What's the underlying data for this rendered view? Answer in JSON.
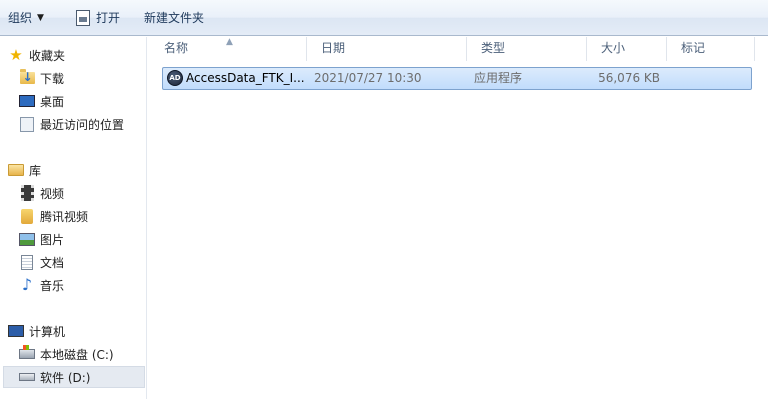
{
  "toolbar": {
    "organize_label": "组织",
    "open_label": "打开",
    "new_folder_label": "新建文件夹"
  },
  "nav": {
    "favorites": {
      "label": "收藏夹",
      "items": [
        {
          "label": "下载",
          "icon": "downloads-folder-icon"
        },
        {
          "label": "桌面",
          "icon": "desktop-icon"
        },
        {
          "label": "最近访问的位置",
          "icon": "recent-places-icon"
        }
      ]
    },
    "libraries": {
      "label": "库",
      "items": [
        {
          "label": "视频",
          "icon": "video-icon"
        },
        {
          "label": "腾讯视频",
          "icon": "tencent-video-folder-icon"
        },
        {
          "label": "图片",
          "icon": "pictures-icon"
        },
        {
          "label": "文档",
          "icon": "documents-icon"
        },
        {
          "label": "音乐",
          "icon": "music-icon"
        }
      ]
    },
    "computer": {
      "label": "计算机",
      "items": [
        {
          "label": "本地磁盘 (C:)",
          "icon": "system-drive-icon"
        },
        {
          "label": "软件 (D:)",
          "icon": "drive-icon",
          "selected": true
        }
      ]
    }
  },
  "columns": [
    "名称",
    "日期",
    "类型",
    "大小",
    "标记"
  ],
  "files": [
    {
      "name": "AccessData_FTK_I...",
      "date": "2021/07/27 10:30",
      "type": "应用程序",
      "size": "56,076 KB",
      "icon": "application-icon",
      "icon_text": "AD",
      "selected": true
    }
  ]
}
